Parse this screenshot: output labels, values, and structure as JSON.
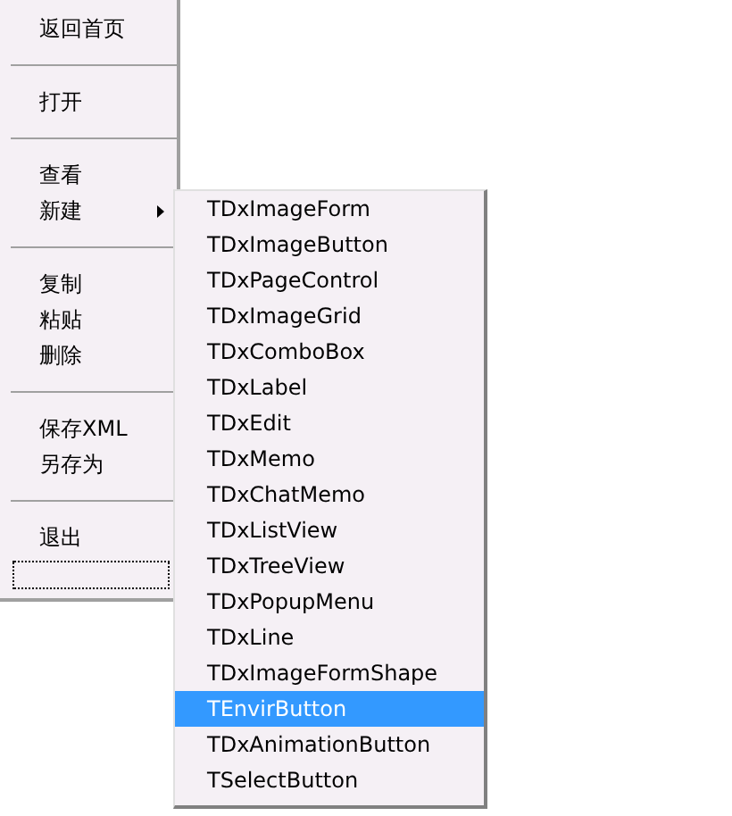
{
  "menu": {
    "items": [
      {
        "kind": "item",
        "label": "返回首页",
        "submenu": false
      },
      {
        "kind": "separator"
      },
      {
        "kind": "item",
        "label": "打开",
        "submenu": false
      },
      {
        "kind": "separator"
      },
      {
        "kind": "item",
        "label": "查看",
        "submenu": false
      },
      {
        "kind": "item",
        "label": "新建",
        "submenu": true
      },
      {
        "kind": "separator"
      },
      {
        "kind": "item",
        "label": "复制",
        "submenu": false
      },
      {
        "kind": "item",
        "label": "粘贴",
        "submenu": false
      },
      {
        "kind": "item",
        "label": "删除",
        "submenu": false
      },
      {
        "kind": "separator"
      },
      {
        "kind": "item",
        "label": "保存XML",
        "submenu": false
      },
      {
        "kind": "item",
        "label": "另存为",
        "submenu": false
      },
      {
        "kind": "separator"
      },
      {
        "kind": "item",
        "label": "退出",
        "submenu": false
      },
      {
        "kind": "focus"
      }
    ]
  },
  "submenu": {
    "items": [
      {
        "label": "TDxImageForm",
        "selected": false
      },
      {
        "label": "TDxImageButton",
        "selected": false
      },
      {
        "label": "TDxPageControl",
        "selected": false
      },
      {
        "label": "TDxImageGrid",
        "selected": false
      },
      {
        "label": "TDxComboBox",
        "selected": false
      },
      {
        "label": "TDxLabel",
        "selected": false
      },
      {
        "label": "TDxEdit",
        "selected": false
      },
      {
        "label": "TDxMemo",
        "selected": false
      },
      {
        "label": "TDxChatMemo",
        "selected": false
      },
      {
        "label": "TDxListView",
        "selected": false
      },
      {
        "label": "TDxTreeView",
        "selected": false
      },
      {
        "label": "TDxPopupMenu",
        "selected": false
      },
      {
        "label": "TDxLine",
        "selected": false
      },
      {
        "label": "TDxImageFormShape",
        "selected": false
      },
      {
        "label": "TEnvirButton",
        "selected": true
      },
      {
        "label": "TDxAnimationButton",
        "selected": false
      },
      {
        "label": "TSelectButton",
        "selected": false
      }
    ]
  }
}
